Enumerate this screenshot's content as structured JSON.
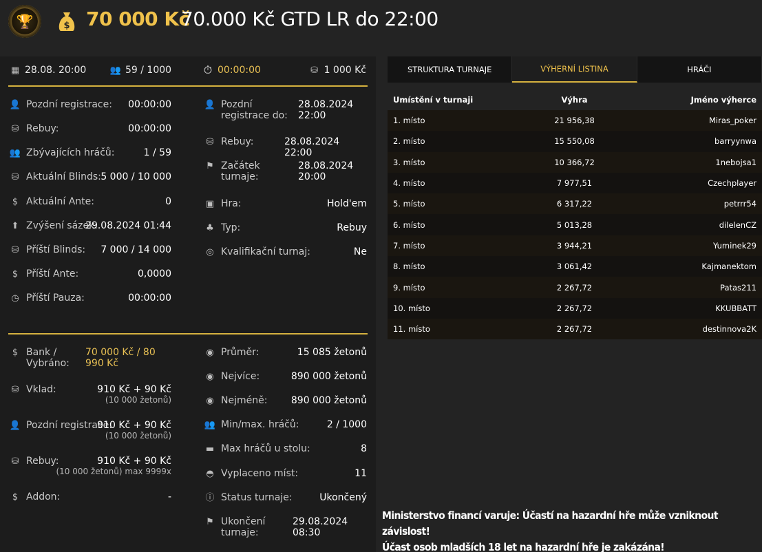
{
  "header": {
    "amount": "70 000 Kč",
    "title": "70.000 Kč GTD LR do 22:00"
  },
  "topbar": {
    "date": "28.08. 20:00",
    "players": "59 / 1000",
    "timer": "00:00:00",
    "buyin": "1 000 Kč"
  },
  "info_left": [
    {
      "label": "Pozdní registrace:",
      "value": "00:00:00"
    },
    {
      "label": "Rebuy:",
      "value": "00:00:00"
    },
    {
      "label": "Zbývajících hráčů:",
      "value": "1 / 59"
    },
    {
      "label": "Aktuální Blinds:",
      "value": "5 000 / 10 000"
    },
    {
      "label": "Aktuální Ante:",
      "value": "0"
    },
    {
      "label": "Zvýšení sázek:",
      "value": "29.08.2024 01:44"
    },
    {
      "label": "Příští Blinds:",
      "value": "7 000 / 14 000"
    },
    {
      "label": "Příští Ante:",
      "value": "0,0000"
    },
    {
      "label": "Příští Pauza:",
      "value": "00:00:00"
    }
  ],
  "info_right": [
    {
      "label": "Pozdní registrace do:",
      "value": "28.08.2024 22:00"
    },
    {
      "label": "Rebuy:",
      "value": "28.08.2024 22:00"
    },
    {
      "label": "Začátek turnaje:",
      "value": "28.08.2024 20:00"
    },
    {
      "label": "Hra:",
      "value": "Hold'em"
    },
    {
      "label": "Typ:",
      "value": "Rebuy"
    },
    {
      "label": "Kvalifikační turnaj:",
      "value": "Ne"
    }
  ],
  "money_left": [
    {
      "label": "Bank / Vybráno:",
      "value": "70 000 Kč / 80 990 Kč",
      "sub": ""
    },
    {
      "label": "Vklad:",
      "value": "910 Kč + 90 Kč",
      "sub": "(10 000 žetonů)"
    },
    {
      "label": "Pozdní registrace:",
      "value": "910 Kč + 90 Kč",
      "sub": "(10 000 žetonů)"
    },
    {
      "label": "Rebuy:",
      "value": "910 Kč + 90 Kč",
      "sub": "(10 000 žetonů) max 9999x"
    },
    {
      "label": "Addon:",
      "value": "-",
      "sub": ""
    }
  ],
  "money_right": [
    {
      "label": "Průměr:",
      "value": "15 085 žetonů"
    },
    {
      "label": "Nejvíce:",
      "value": "890 000 žetonů"
    },
    {
      "label": "Nejméně:",
      "value": "890 000 žetonů"
    },
    {
      "label": "Min/max. hráčů:",
      "value": "2 / 1000"
    },
    {
      "label": "Max hráčů u stolu:",
      "value": "8"
    },
    {
      "label": "Vyplaceno míst:",
      "value": "11"
    },
    {
      "label": "Status turnaje:",
      "value": "Ukončený"
    },
    {
      "label": "Ukončení turnaje:",
      "value": "29.08.2024 08:30"
    }
  ],
  "tabs": [
    "STRUKTURA TURNAJE",
    "VÝHERNÍ LISTINA",
    "HRÁČI"
  ],
  "table": {
    "headers": [
      "Umístění v turnaji",
      "Výhra",
      "Jméno výherce"
    ],
    "rows": [
      [
        "1. místo",
        "21 956,38",
        "Miras_poker"
      ],
      [
        "2. místo",
        "15 550,08",
        "barryynwa"
      ],
      [
        "3. místo",
        "10 366,72",
        "1nebojsa1"
      ],
      [
        "4. místo",
        "7 977,51",
        "Czechplayer"
      ],
      [
        "5. místo",
        "6 317,22",
        "petrrr54"
      ],
      [
        "6. místo",
        "5 013,28",
        "dilelenCZ"
      ],
      [
        "7. místo",
        "3 944,21",
        "Yuminek29"
      ],
      [
        "8. místo",
        "3 061,42",
        "Kajmanektom"
      ],
      [
        "9. místo",
        "2 267,72",
        "Patas211"
      ],
      [
        "10. místo",
        "2 267,72",
        "KKUBBATT"
      ],
      [
        "11. místo",
        "2 267,72",
        "destinnova2K"
      ]
    ]
  },
  "warning": {
    "line1": "Ministerstvo financí varuje: Účastí na hazardní hře může vzniknout závislost!",
    "line2": "Účast osob mladších 18 let na hazardní hře je zakázána!"
  },
  "colors": {
    "accent": "#d6b23f",
    "gold_text": "#f0c24b"
  }
}
